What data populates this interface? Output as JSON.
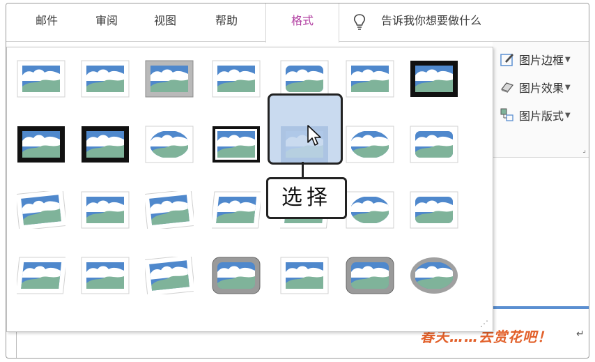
{
  "tabs": [
    {
      "label": "邮件"
    },
    {
      "label": "审阅"
    },
    {
      "label": "视图"
    },
    {
      "label": "帮助"
    },
    {
      "label": "格式",
      "active": true
    }
  ],
  "tell_me": {
    "text": "告诉我你想要做什么",
    "icon": "lightbulb-icon"
  },
  "ribbon": {
    "border_label": "图片边框",
    "effects_label": "图片效果",
    "layout_label": "图片版式"
  },
  "callout": {
    "text": "选择"
  },
  "document": {
    "text": "春天……去赏花吧！"
  },
  "gallery": {
    "styles": [
      "simple-frame-white",
      "soft-edge-rectangle",
      "beveled-matte-gray",
      "drop-shadow-rectangle",
      "reflected-rounded-rectangle",
      "soft-edge-plain",
      "simple-frame-black",
      "thick-matte-black",
      "metal-frame-black",
      "oval-shadow",
      "double-frame-black",
      "thick-matte-blue",
      "soft-edge-oval-lite",
      "rounded-frame",
      "snip-diagonal-white",
      "center-shadow-rectangle",
      "rotated-white",
      "perspective-shadow-white",
      "relaxed-perspective-white",
      "soft-edge-oval",
      "bevel-rounded-blue",
      "bevel-perspective",
      "reflected-bevel-white",
      "perspective-tilt-white",
      "metal-rounded-rectangle",
      "reflected-white",
      "metal-rounded-gray",
      "metal-oval"
    ],
    "selected_index": 4
  },
  "colors": {
    "accent_tab": "#b03ca0",
    "sky": "#4f88cc",
    "hill": "#7fb39a",
    "selection_fill": "#bfd4ec"
  }
}
